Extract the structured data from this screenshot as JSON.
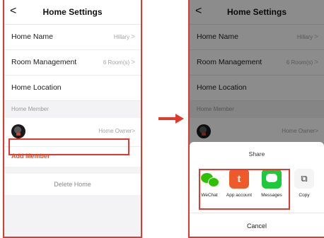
{
  "header": {
    "title": "Home Settings",
    "back_glyph": "<"
  },
  "rows": [
    {
      "label": "Home Name",
      "value": "Hillary"
    },
    {
      "label": "Room Management",
      "value": "6 Room(s)"
    },
    {
      "label": "Home Location",
      "value": ""
    }
  ],
  "chevron": ">",
  "member_section": {
    "heading": "Home Member",
    "member_role": "Home Owner"
  },
  "add_member_label": "Add Member",
  "delete_label": "Delete Home",
  "share_sheet": {
    "title": "Share",
    "items": [
      {
        "label": "WeChat",
        "icon": "wechat-icon"
      },
      {
        "label": "App account",
        "icon": "app-account-icon"
      },
      {
        "label": "Messages",
        "icon": "messages-icon"
      },
      {
        "label": "Copy",
        "icon": "copy-icon"
      }
    ],
    "app_glyph": "t",
    "copy_glyph": "⧉",
    "cancel_label": "Cancel"
  },
  "colors": {
    "highlight": "#e03a2e",
    "accent": "#e94c2b",
    "wechat": "#2dc100",
    "messages": "#1ec83b"
  }
}
